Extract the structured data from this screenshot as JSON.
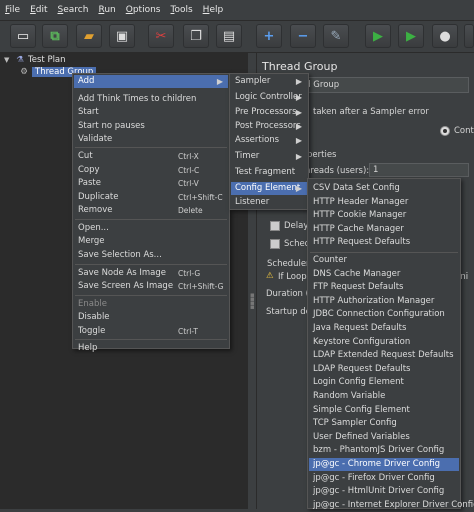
{
  "menubar": [
    "File",
    "Edit",
    "Search",
    "Run",
    "Options",
    "Tools",
    "Help"
  ],
  "tree": {
    "root": "Test Plan",
    "child": "Thread Group"
  },
  "right_panel": {
    "title": "Thread Group",
    "name_value": "ad Group",
    "sampler_error_label": "taken after a Sampler error",
    "continue_label": "Conti",
    "properties_label": "perties",
    "threads_label": "hreads (users):",
    "threads_value": "1",
    "delay_label": "Delay T",
    "schedule_label": "Schedu",
    "scheduler_label": "Scheduler",
    "if_loop_label": "If Loop C",
    "duration_label": "Duration (se",
    "startup_label": "Startup dela",
    "ini_label": "ini"
  },
  "context_menu": {
    "add": "Add",
    "items": [
      {
        "label": "Add Think Times to children"
      },
      {
        "label": "Start"
      },
      {
        "label": "Start no pauses"
      },
      {
        "label": "Validate"
      },
      {
        "label": "Cut",
        "shortcut": "Ctrl-X"
      },
      {
        "label": "Copy",
        "shortcut": "Ctrl-C"
      },
      {
        "label": "Paste",
        "shortcut": "Ctrl-V"
      },
      {
        "label": "Duplicate",
        "shortcut": "Ctrl+Shift-C"
      },
      {
        "label": "Remove",
        "shortcut": "Delete"
      },
      {
        "label": "Open..."
      },
      {
        "label": "Merge"
      },
      {
        "label": "Save Selection As..."
      },
      {
        "label": "Save Node As Image",
        "shortcut": "Ctrl-G"
      },
      {
        "label": "Save Screen As Image",
        "shortcut": "Ctrl+Shift-G"
      },
      {
        "label": "Enable"
      },
      {
        "label": "Disable"
      },
      {
        "label": "Toggle",
        "shortcut": "Ctrl-T"
      },
      {
        "label": "Help"
      }
    ]
  },
  "add_submenu": [
    "Sampler",
    "Logic Controller",
    "Pre Processors",
    "Post Processors",
    "Assertions",
    "Timer",
    "Test Fragment",
    "Config Element",
    "Listener"
  ],
  "config_submenu": [
    "CSV Data Set Config",
    "HTTP Header Manager",
    "HTTP Cookie Manager",
    "HTTP Cache Manager",
    "HTTP Request Defaults",
    "Counter",
    "DNS Cache Manager",
    "FTP Request Defaults",
    "HTTP Authorization Manager",
    "JDBC Connection Configuration",
    "Java Request Defaults",
    "Keystore Configuration",
    "LDAP Extended Request Defaults",
    "LDAP Request Defaults",
    "Login Config Element",
    "Random Variable",
    "Simple Config Element",
    "TCP Sampler Config",
    "User Defined Variables",
    "bzm - PhantomJS Driver Config",
    "jp@gc - Chrome Driver Config",
    "jp@gc - Firefox Driver Config",
    "jp@gc - HtmlUnit Driver Config",
    "jp@gc - Internet Explorer Driver Config"
  ],
  "colors": {
    "highlight": "#4b6eaf",
    "background": "#3c3f41",
    "tree_bg": "#2b2b2b"
  }
}
